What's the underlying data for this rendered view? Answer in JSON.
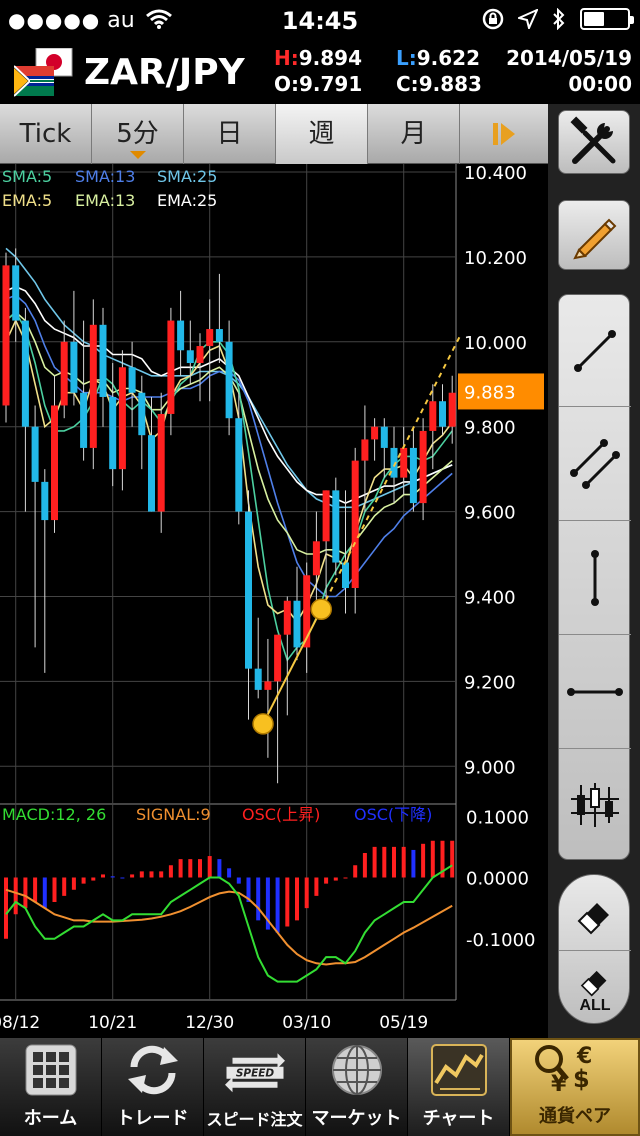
{
  "status": {
    "carrier": "au",
    "time": "14:45"
  },
  "header": {
    "pair": "ZAR/JPY",
    "high_label": "H:",
    "high": "9.894",
    "low_label": "L:",
    "low": "9.622",
    "open_label": "O:",
    "open": "9.791",
    "close_label": "C:",
    "close": "9.883",
    "date": "2014/05/19",
    "clock": "00:00"
  },
  "tabs": [
    {
      "label": "Tick",
      "active": false
    },
    {
      "label": "5分",
      "active": false
    },
    {
      "label": "日",
      "active": false
    },
    {
      "label": "週",
      "active": true
    },
    {
      "label": "月",
      "active": false
    }
  ],
  "tools": {
    "settings_icon": "tools-icon",
    "pencil_icon": "pencil-icon",
    "items": [
      "trendline-icon",
      "channel-icon",
      "vertical-line-icon",
      "horizontal-line-icon",
      "candle-grid-icon"
    ],
    "eraser_all_label": "ALL"
  },
  "indicators": {
    "sma5": "SMA:5",
    "sma13": "SMA:13",
    "sma25": "SMA:25",
    "ema5": "EMA:5",
    "ema13": "EMA:13",
    "ema25": "EMA:25",
    "macd": "MACD:12, 26",
    "signal": "SIGNAL:9",
    "osc_up": "OSC(上昇)",
    "osc_down": "OSC(下降)"
  },
  "colors": {
    "up": "#ff2020",
    "down": "#22b8e8",
    "sma5": "#4cd0a0",
    "sma13": "#4f7fe8",
    "sma25": "#6fc6e8",
    "ema5": "#f0e08a",
    "ema13": "#d8f0a0",
    "ema25": "#ffffff",
    "macd": "#33dd33",
    "signal": "#f09030",
    "osc_up": "#ff2020",
    "osc_down": "#2030ff",
    "current_price_bg": "#ff8c00",
    "trend": "#f5c842"
  },
  "chart_data": {
    "type": "candlestick",
    "current_price": "9.883",
    "price_ticks": [
      "10.400",
      "10.200",
      "10.000",
      "9.800",
      "9.600",
      "9.400",
      "9.200",
      "9.000"
    ],
    "price_tick_values": [
      10.4,
      10.2,
      10.0,
      9.8,
      9.6,
      9.4,
      9.2,
      9.0
    ],
    "ylim": [
      8.93,
      10.4
    ],
    "osc_ticks": [
      "0.1000",
      "0.0000",
      "-0.1000"
    ],
    "osc_tick_values": [
      0.1,
      0.0,
      -0.1
    ],
    "osc_ylim": [
      -0.2,
      0.12
    ],
    "date_labels": [
      "08/12",
      "10/21",
      "12/30",
      "03/10",
      "05/19"
    ],
    "date_label_index": [
      1,
      11,
      21,
      31,
      41
    ],
    "candles": [
      {
        "o": 9.85,
        "h": 10.21,
        "l": 9.81,
        "c": 10.18
      },
      {
        "o": 10.18,
        "h": 10.22,
        "l": 10.0,
        "c": 10.05
      },
      {
        "o": 10.05,
        "h": 10.08,
        "l": 9.6,
        "c": 9.8
      },
      {
        "o": 9.8,
        "h": 9.85,
        "l": 9.28,
        "c": 9.67
      },
      {
        "o": 9.67,
        "h": 9.7,
        "l": 9.22,
        "c": 9.58
      },
      {
        "o": 9.58,
        "h": 9.92,
        "l": 9.55,
        "c": 9.85
      },
      {
        "o": 9.85,
        "h": 10.05,
        "l": 9.82,
        "c": 10.0
      },
      {
        "o": 10.0,
        "h": 10.12,
        "l": 9.85,
        "c": 9.88
      },
      {
        "o": 9.88,
        "h": 10.05,
        "l": 9.72,
        "c": 9.75
      },
      {
        "o": 9.75,
        "h": 10.1,
        "l": 9.7,
        "c": 10.04
      },
      {
        "o": 10.04,
        "h": 10.08,
        "l": 9.8,
        "c": 9.87
      },
      {
        "o": 9.87,
        "h": 9.95,
        "l": 9.66,
        "c": 9.7
      },
      {
        "o": 9.7,
        "h": 9.98,
        "l": 9.65,
        "c": 9.94
      },
      {
        "o": 9.94,
        "h": 10.0,
        "l": 9.8,
        "c": 9.88
      },
      {
        "o": 9.88,
        "h": 9.92,
        "l": 9.7,
        "c": 9.78
      },
      {
        "o": 9.78,
        "h": 9.87,
        "l": 9.6,
        "c": 9.6
      },
      {
        "o": 9.6,
        "h": 9.88,
        "l": 9.55,
        "c": 9.83
      },
      {
        "o": 9.83,
        "h": 10.08,
        "l": 9.78,
        "c": 10.05
      },
      {
        "o": 10.05,
        "h": 10.12,
        "l": 9.92,
        "c": 9.98
      },
      {
        "o": 9.98,
        "h": 10.05,
        "l": 9.9,
        "c": 9.95
      },
      {
        "o": 9.95,
        "h": 10.02,
        "l": 9.86,
        "c": 9.99
      },
      {
        "o": 9.99,
        "h": 10.1,
        "l": 9.86,
        "c": 10.03
      },
      {
        "o": 10.03,
        "h": 10.16,
        "l": 9.95,
        "c": 10.0
      },
      {
        "o": 10.0,
        "h": 10.05,
        "l": 9.78,
        "c": 9.82
      },
      {
        "o": 9.82,
        "h": 9.88,
        "l": 9.57,
        "c": 9.6
      },
      {
        "o": 9.6,
        "h": 9.65,
        "l": 9.11,
        "c": 9.23
      },
      {
        "o": 9.23,
        "h": 9.35,
        "l": 9.16,
        "c": 9.18
      },
      {
        "o": 9.18,
        "h": 9.3,
        "l": 9.02,
        "c": 9.2
      },
      {
        "o": 9.2,
        "h": 9.31,
        "l": 8.96,
        "c": 9.31
      },
      {
        "o": 9.31,
        "h": 9.4,
        "l": 9.12,
        "c": 9.39
      },
      {
        "o": 9.39,
        "h": 9.47,
        "l": 9.25,
        "c": 9.28
      },
      {
        "o": 9.28,
        "h": 9.48,
        "l": 9.22,
        "c": 9.45
      },
      {
        "o": 9.45,
        "h": 9.6,
        "l": 9.35,
        "c": 9.53
      },
      {
        "o": 9.53,
        "h": 9.65,
        "l": 9.38,
        "c": 9.65
      },
      {
        "o": 9.65,
        "h": 9.68,
        "l": 9.45,
        "c": 9.48
      },
      {
        "o": 9.48,
        "h": 9.65,
        "l": 9.36,
        "c": 9.42
      },
      {
        "o": 9.42,
        "h": 9.75,
        "l": 9.36,
        "c": 9.72
      },
      {
        "o": 9.72,
        "h": 9.85,
        "l": 9.6,
        "c": 9.77
      },
      {
        "o": 9.77,
        "h": 9.82,
        "l": 9.72,
        "c": 9.8
      },
      {
        "o": 9.8,
        "h": 9.82,
        "l": 9.68,
        "c": 9.75
      },
      {
        "o": 9.75,
        "h": 9.8,
        "l": 9.62,
        "c": 9.68
      },
      {
        "o": 9.68,
        "h": 9.8,
        "l": 9.64,
        "c": 9.75
      },
      {
        "o": 9.75,
        "h": 9.8,
        "l": 9.6,
        "c": 9.62
      },
      {
        "o": 9.62,
        "h": 9.82,
        "l": 9.58,
        "c": 9.79
      },
      {
        "o": 9.79,
        "h": 9.9,
        "l": 9.7,
        "c": 9.86
      },
      {
        "o": 9.86,
        "h": 9.9,
        "l": 9.78,
        "c": 9.8
      },
      {
        "o": 9.8,
        "h": 9.92,
        "l": 9.76,
        "c": 9.88
      }
    ],
    "sma5": [
      10.05,
      10.07,
      10.03,
      9.95,
      9.85,
      9.79,
      9.79,
      9.8,
      9.82,
      9.86,
      9.92,
      9.9,
      9.86,
      9.84,
      9.86,
      9.84,
      9.81,
      9.86,
      9.9,
      9.92,
      9.98,
      10.0,
      10.0,
      9.97,
      9.89,
      9.74,
      9.58,
      9.42,
      9.32,
      9.25,
      9.28,
      9.3,
      9.35,
      9.42,
      9.46,
      9.5,
      9.53,
      9.6,
      9.63,
      9.68,
      9.71,
      9.73,
      9.73,
      9.72,
      9.73,
      9.76,
      9.79
    ],
    "sma13": [
      10.1,
      10.11,
      10.09,
      10.05,
      9.99,
      9.94,
      9.92,
      9.9,
      9.88,
      9.88,
      9.88,
      9.87,
      9.86,
      9.87,
      9.87,
      9.87,
      9.87,
      9.88,
      9.89,
      9.89,
      9.9,
      9.92,
      9.93,
      9.93,
      9.91,
      9.86,
      9.78,
      9.7,
      9.62,
      9.55,
      9.48,
      9.44,
      9.42,
      9.4,
      9.4,
      9.42,
      9.45,
      9.48,
      9.51,
      9.54,
      9.56,
      9.59,
      9.61,
      9.63,
      9.65,
      9.67,
      9.69
    ],
    "sma25": [
      10.22,
      10.2,
      10.17,
      10.14,
      10.1,
      10.07,
      10.04,
      10.02,
      10.0,
      9.99,
      9.97,
      9.96,
      9.95,
      9.94,
      9.93,
      9.92,
      9.92,
      9.92,
      9.92,
      9.92,
      9.93,
      9.93,
      9.93,
      9.92,
      9.9,
      9.87,
      9.83,
      9.79,
      9.75,
      9.71,
      9.68,
      9.65,
      9.63,
      9.62,
      9.61,
      9.61,
      9.61,
      9.62,
      9.63,
      9.64,
      9.65,
      9.66,
      9.67,
      9.68,
      9.69,
      9.7,
      9.71
    ],
    "ema5": [
      10.0,
      10.05,
      10.0,
      9.9,
      9.8,
      9.82,
      9.88,
      9.88,
      9.84,
      9.91,
      9.9,
      9.84,
      9.87,
      9.88,
      9.85,
      9.77,
      9.79,
      9.87,
      9.91,
      9.92,
      9.95,
      9.98,
      9.99,
      9.93,
      9.82,
      9.62,
      9.47,
      9.38,
      9.36,
      9.37,
      9.34,
      9.38,
      9.43,
      9.5,
      9.49,
      9.47,
      9.55,
      9.62,
      9.68,
      9.7,
      9.7,
      9.71,
      9.68,
      9.72,
      9.76,
      9.78,
      9.81
    ],
    "ema13": [
      10.05,
      10.07,
      10.05,
      10.0,
      9.94,
      9.92,
      9.93,
      9.92,
      9.9,
      9.91,
      9.91,
      9.88,
      9.89,
      9.89,
      9.88,
      9.84,
      9.84,
      9.87,
      9.89,
      9.9,
      9.91,
      9.93,
      9.94,
      9.92,
      9.88,
      9.79,
      9.7,
      9.63,
      9.58,
      9.55,
      9.51,
      9.5,
      9.5,
      9.51,
      9.51,
      9.5,
      9.53,
      9.56,
      9.59,
      9.61,
      9.62,
      9.64,
      9.64,
      9.66,
      9.68,
      9.7,
      9.72
    ],
    "ema25": [
      10.12,
      10.13,
      10.12,
      10.09,
      10.05,
      10.03,
      10.02,
      10.01,
      9.99,
      9.99,
      9.99,
      9.97,
      9.97,
      9.97,
      9.96,
      9.93,
      9.92,
      9.93,
      9.94,
      9.94,
      9.94,
      9.95,
      9.96,
      9.94,
      9.92,
      9.87,
      9.82,
      9.77,
      9.73,
      9.7,
      9.67,
      9.65,
      9.64,
      9.64,
      9.63,
      9.62,
      9.63,
      9.64,
      9.65,
      9.66,
      9.66,
      9.67,
      9.67,
      9.68,
      9.69,
      9.7,
      9.71
    ],
    "macd": [
      -0.06,
      -0.04,
      -0.05,
      -0.08,
      -0.1,
      -0.1,
      -0.09,
      -0.08,
      -0.08,
      -0.07,
      -0.06,
      -0.07,
      -0.07,
      -0.06,
      -0.06,
      -0.06,
      -0.06,
      -0.04,
      -0.03,
      -0.02,
      -0.01,
      0.0,
      0.0,
      -0.01,
      -0.03,
      -0.08,
      -0.13,
      -0.16,
      -0.17,
      -0.17,
      -0.17,
      -0.16,
      -0.15,
      -0.13,
      -0.13,
      -0.14,
      -0.12,
      -0.09,
      -0.07,
      -0.06,
      -0.05,
      -0.04,
      -0.04,
      -0.02,
      0.0,
      0.01,
      0.02
    ],
    "signal": [
      -0.02,
      -0.025,
      -0.03,
      -0.04,
      -0.05,
      -0.06,
      -0.065,
      -0.07,
      -0.07,
      -0.072,
      -0.072,
      -0.072,
      -0.071,
      -0.07,
      -0.069,
      -0.067,
      -0.064,
      -0.06,
      -0.055,
      -0.048,
      -0.04,
      -0.032,
      -0.026,
      -0.023,
      -0.025,
      -0.035,
      -0.05,
      -0.07,
      -0.09,
      -0.11,
      -0.125,
      -0.135,
      -0.14,
      -0.142,
      -0.14,
      -0.14,
      -0.138,
      -0.13,
      -0.12,
      -0.11,
      -0.1,
      -0.09,
      -0.082,
      -0.073,
      -0.064,
      -0.055,
      -0.046
    ],
    "osc": [
      -0.1,
      -0.06,
      -0.05,
      -0.04,
      -0.05,
      -0.04,
      -0.03,
      -0.02,
      -0.01,
      -0.005,
      0.005,
      0.002,
      -0.001,
      0.005,
      0.01,
      0.01,
      0.01,
      0.02,
      0.03,
      0.03,
      0.03,
      0.035,
      0.03,
      0.015,
      -0.01,
      -0.04,
      -0.07,
      -0.085,
      -0.09,
      -0.08,
      -0.07,
      -0.05,
      -0.03,
      -0.01,
      -0.005,
      0.0,
      0.02,
      0.04,
      0.05,
      0.05,
      0.05,
      0.05,
      0.045,
      0.055,
      0.06,
      0.06,
      0.06
    ],
    "trendline": {
      "p1": {
        "i": 26.5,
        "v": 9.1
      },
      "p2": {
        "i": 32.5,
        "v": 9.37
      }
    }
  },
  "bottom_nav": [
    {
      "label": "ホーム",
      "icon": "home-grid-icon",
      "active": false
    },
    {
      "label": "トレード",
      "icon": "trade-arrows-icon",
      "active": false
    },
    {
      "label": "スピード注文",
      "icon": "speed-order-icon",
      "active": false,
      "badge": "SPEED"
    },
    {
      "label": "マーケット",
      "icon": "globe-icon",
      "active": false
    },
    {
      "label": "チャート",
      "icon": "chart-icon",
      "active": true
    },
    {
      "label": "通貨ペア",
      "icon": "currency-pair-icon",
      "active": false,
      "sym1": "€",
      "sym2": "¥",
      "sym3": "$"
    }
  ]
}
